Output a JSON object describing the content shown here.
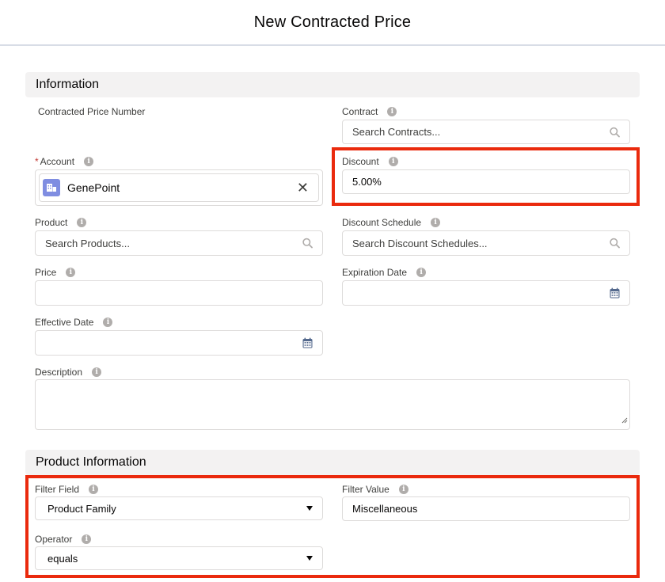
{
  "modal": {
    "title": "New Contracted Price"
  },
  "sections": {
    "information": "Information",
    "product_information": "Product Information"
  },
  "fields": {
    "contracted_price_number": {
      "label": "Contracted Price Number"
    },
    "contract": {
      "label": "Contract",
      "placeholder": "Search Contracts..."
    },
    "account": {
      "required_marker": "*",
      "label": "Account",
      "value": "GenePoint"
    },
    "discount": {
      "label": "Discount",
      "value": "5.00%"
    },
    "product": {
      "label": "Product",
      "placeholder": "Search Products..."
    },
    "discount_schedule": {
      "label": "Discount Schedule",
      "placeholder": "Search Discount Schedules..."
    },
    "price": {
      "label": "Price",
      "value": ""
    },
    "expiration_date": {
      "label": "Expiration Date",
      "value": ""
    },
    "effective_date": {
      "label": "Effective Date",
      "value": ""
    },
    "description": {
      "label": "Description",
      "value": ""
    },
    "filter_field": {
      "label": "Filter Field",
      "value": "Product Family"
    },
    "filter_value": {
      "label": "Filter Value",
      "value": "Miscellaneous"
    },
    "operator": {
      "label": "Operator",
      "value": "equals"
    }
  },
  "icons": {
    "info": "info-icon",
    "search": "search-icon",
    "calendar": "calendar-icon",
    "account_object": "account-icon",
    "clear": "close-icon",
    "caret": "chevron-down-icon"
  },
  "glyphs": {
    "info": "i",
    "clear": "✕"
  },
  "colors": {
    "highlight": "#ea2a0d",
    "account_icon": "#7f8de1",
    "section_bg": "#f3f2f2",
    "required": "#c23934"
  }
}
